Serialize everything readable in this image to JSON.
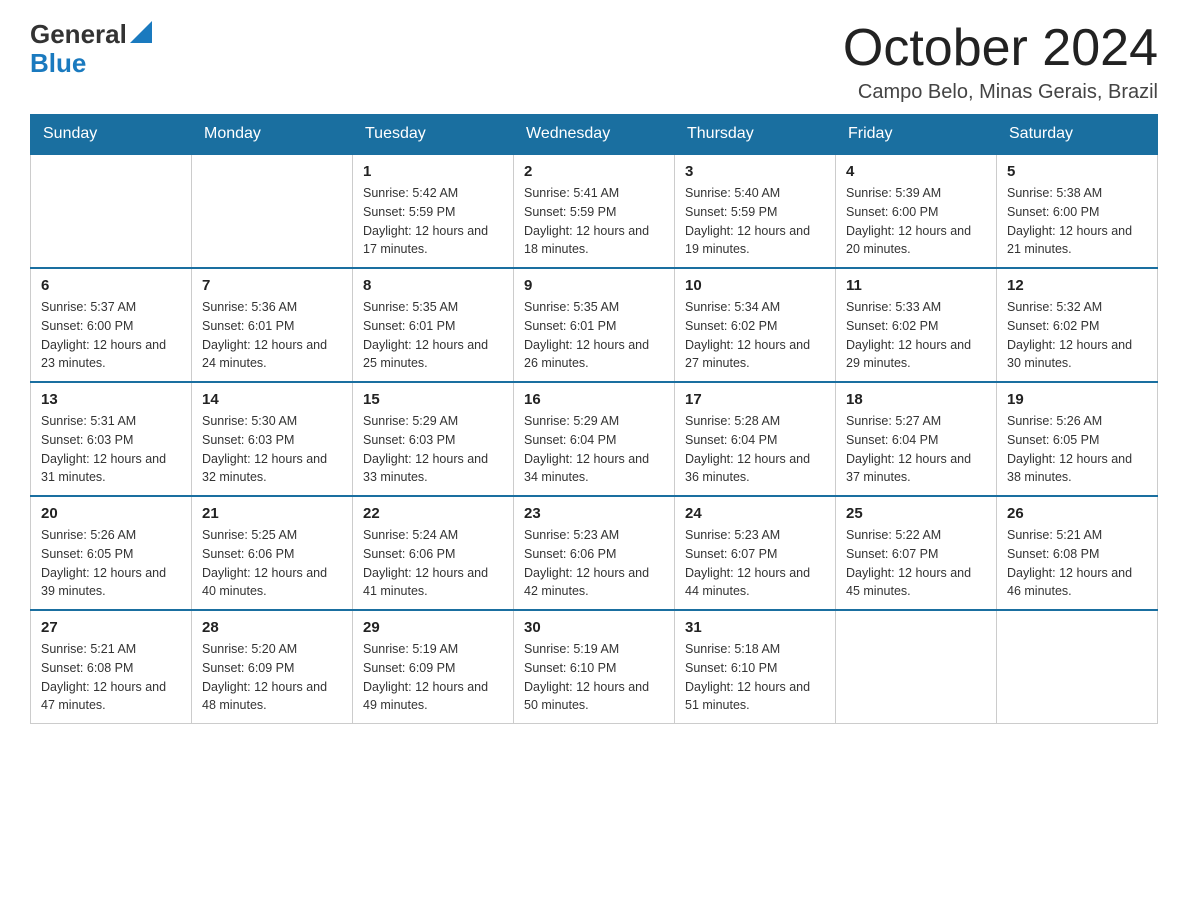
{
  "header": {
    "logo_general": "General",
    "logo_blue": "Blue",
    "month_title": "October 2024",
    "subtitle": "Campo Belo, Minas Gerais, Brazil"
  },
  "days_of_week": [
    "Sunday",
    "Monday",
    "Tuesday",
    "Wednesday",
    "Thursday",
    "Friday",
    "Saturday"
  ],
  "weeks": [
    [
      {
        "day": "",
        "sunrise": "",
        "sunset": "",
        "daylight": ""
      },
      {
        "day": "",
        "sunrise": "",
        "sunset": "",
        "daylight": ""
      },
      {
        "day": "1",
        "sunrise": "Sunrise: 5:42 AM",
        "sunset": "Sunset: 5:59 PM",
        "daylight": "Daylight: 12 hours and 17 minutes."
      },
      {
        "day": "2",
        "sunrise": "Sunrise: 5:41 AM",
        "sunset": "Sunset: 5:59 PM",
        "daylight": "Daylight: 12 hours and 18 minutes."
      },
      {
        "day": "3",
        "sunrise": "Sunrise: 5:40 AM",
        "sunset": "Sunset: 5:59 PM",
        "daylight": "Daylight: 12 hours and 19 minutes."
      },
      {
        "day": "4",
        "sunrise": "Sunrise: 5:39 AM",
        "sunset": "Sunset: 6:00 PM",
        "daylight": "Daylight: 12 hours and 20 minutes."
      },
      {
        "day": "5",
        "sunrise": "Sunrise: 5:38 AM",
        "sunset": "Sunset: 6:00 PM",
        "daylight": "Daylight: 12 hours and 21 minutes."
      }
    ],
    [
      {
        "day": "6",
        "sunrise": "Sunrise: 5:37 AM",
        "sunset": "Sunset: 6:00 PM",
        "daylight": "Daylight: 12 hours and 23 minutes."
      },
      {
        "day": "7",
        "sunrise": "Sunrise: 5:36 AM",
        "sunset": "Sunset: 6:01 PM",
        "daylight": "Daylight: 12 hours and 24 minutes."
      },
      {
        "day": "8",
        "sunrise": "Sunrise: 5:35 AM",
        "sunset": "Sunset: 6:01 PM",
        "daylight": "Daylight: 12 hours and 25 minutes."
      },
      {
        "day": "9",
        "sunrise": "Sunrise: 5:35 AM",
        "sunset": "Sunset: 6:01 PM",
        "daylight": "Daylight: 12 hours and 26 minutes."
      },
      {
        "day": "10",
        "sunrise": "Sunrise: 5:34 AM",
        "sunset": "Sunset: 6:02 PM",
        "daylight": "Daylight: 12 hours and 27 minutes."
      },
      {
        "day": "11",
        "sunrise": "Sunrise: 5:33 AM",
        "sunset": "Sunset: 6:02 PM",
        "daylight": "Daylight: 12 hours and 29 minutes."
      },
      {
        "day": "12",
        "sunrise": "Sunrise: 5:32 AM",
        "sunset": "Sunset: 6:02 PM",
        "daylight": "Daylight: 12 hours and 30 minutes."
      }
    ],
    [
      {
        "day": "13",
        "sunrise": "Sunrise: 5:31 AM",
        "sunset": "Sunset: 6:03 PM",
        "daylight": "Daylight: 12 hours and 31 minutes."
      },
      {
        "day": "14",
        "sunrise": "Sunrise: 5:30 AM",
        "sunset": "Sunset: 6:03 PM",
        "daylight": "Daylight: 12 hours and 32 minutes."
      },
      {
        "day": "15",
        "sunrise": "Sunrise: 5:29 AM",
        "sunset": "Sunset: 6:03 PM",
        "daylight": "Daylight: 12 hours and 33 minutes."
      },
      {
        "day": "16",
        "sunrise": "Sunrise: 5:29 AM",
        "sunset": "Sunset: 6:04 PM",
        "daylight": "Daylight: 12 hours and 34 minutes."
      },
      {
        "day": "17",
        "sunrise": "Sunrise: 5:28 AM",
        "sunset": "Sunset: 6:04 PM",
        "daylight": "Daylight: 12 hours and 36 minutes."
      },
      {
        "day": "18",
        "sunrise": "Sunrise: 5:27 AM",
        "sunset": "Sunset: 6:04 PM",
        "daylight": "Daylight: 12 hours and 37 minutes."
      },
      {
        "day": "19",
        "sunrise": "Sunrise: 5:26 AM",
        "sunset": "Sunset: 6:05 PM",
        "daylight": "Daylight: 12 hours and 38 minutes."
      }
    ],
    [
      {
        "day": "20",
        "sunrise": "Sunrise: 5:26 AM",
        "sunset": "Sunset: 6:05 PM",
        "daylight": "Daylight: 12 hours and 39 minutes."
      },
      {
        "day": "21",
        "sunrise": "Sunrise: 5:25 AM",
        "sunset": "Sunset: 6:06 PM",
        "daylight": "Daylight: 12 hours and 40 minutes."
      },
      {
        "day": "22",
        "sunrise": "Sunrise: 5:24 AM",
        "sunset": "Sunset: 6:06 PM",
        "daylight": "Daylight: 12 hours and 41 minutes."
      },
      {
        "day": "23",
        "sunrise": "Sunrise: 5:23 AM",
        "sunset": "Sunset: 6:06 PM",
        "daylight": "Daylight: 12 hours and 42 minutes."
      },
      {
        "day": "24",
        "sunrise": "Sunrise: 5:23 AM",
        "sunset": "Sunset: 6:07 PM",
        "daylight": "Daylight: 12 hours and 44 minutes."
      },
      {
        "day": "25",
        "sunrise": "Sunrise: 5:22 AM",
        "sunset": "Sunset: 6:07 PM",
        "daylight": "Daylight: 12 hours and 45 minutes."
      },
      {
        "day": "26",
        "sunrise": "Sunrise: 5:21 AM",
        "sunset": "Sunset: 6:08 PM",
        "daylight": "Daylight: 12 hours and 46 minutes."
      }
    ],
    [
      {
        "day": "27",
        "sunrise": "Sunrise: 5:21 AM",
        "sunset": "Sunset: 6:08 PM",
        "daylight": "Daylight: 12 hours and 47 minutes."
      },
      {
        "day": "28",
        "sunrise": "Sunrise: 5:20 AM",
        "sunset": "Sunset: 6:09 PM",
        "daylight": "Daylight: 12 hours and 48 minutes."
      },
      {
        "day": "29",
        "sunrise": "Sunrise: 5:19 AM",
        "sunset": "Sunset: 6:09 PM",
        "daylight": "Daylight: 12 hours and 49 minutes."
      },
      {
        "day": "30",
        "sunrise": "Sunrise: 5:19 AM",
        "sunset": "Sunset: 6:10 PM",
        "daylight": "Daylight: 12 hours and 50 minutes."
      },
      {
        "day": "31",
        "sunrise": "Sunrise: 5:18 AM",
        "sunset": "Sunset: 6:10 PM",
        "daylight": "Daylight: 12 hours and 51 minutes."
      },
      {
        "day": "",
        "sunrise": "",
        "sunset": "",
        "daylight": ""
      },
      {
        "day": "",
        "sunrise": "",
        "sunset": "",
        "daylight": ""
      }
    ]
  ]
}
